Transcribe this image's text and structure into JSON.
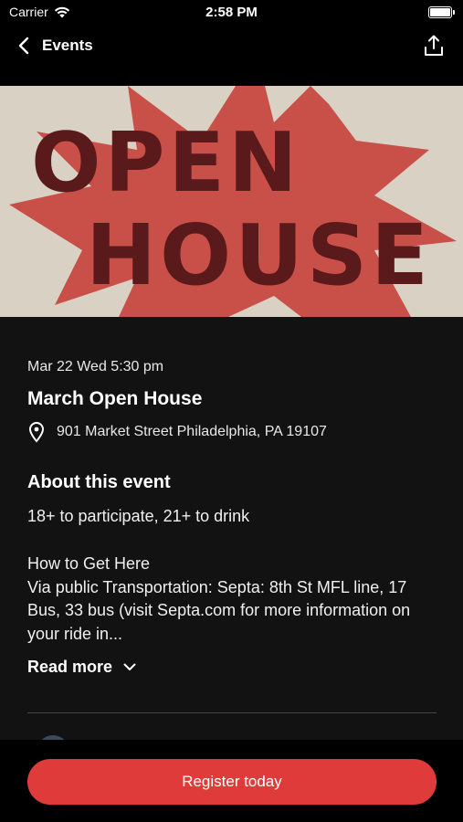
{
  "status_bar": {
    "carrier": "Carrier",
    "time": "2:58 PM"
  },
  "nav": {
    "title": "Events",
    "back_icon": "chevron-left-icon",
    "share_icon": "share-icon"
  },
  "hero": {
    "line1": "OPEN",
    "line2": "HOUSE",
    "background_color": "#d9d2c4",
    "star_color": "#c8443e",
    "text_color": "#5a1a1c"
  },
  "event": {
    "date": "Mar 22 Wed 5:30 pm",
    "title": "March Open House",
    "location": "901 Market Street Philadelphia, PA 19107",
    "location_icon": "location-pin-icon"
  },
  "about": {
    "heading": "About this event",
    "age_note": "18+ to participate, 21+ to drink",
    "description_heading": "How to Get Here",
    "description": "Via public Transportation: Septa: 8th St MFL line, 17 Bus, 33 bus (visit Septa.com for more information on your ride in...",
    "read_more": "Read more"
  },
  "footer": {
    "register_label": "Register today",
    "accent_color": "#e03b3b"
  }
}
